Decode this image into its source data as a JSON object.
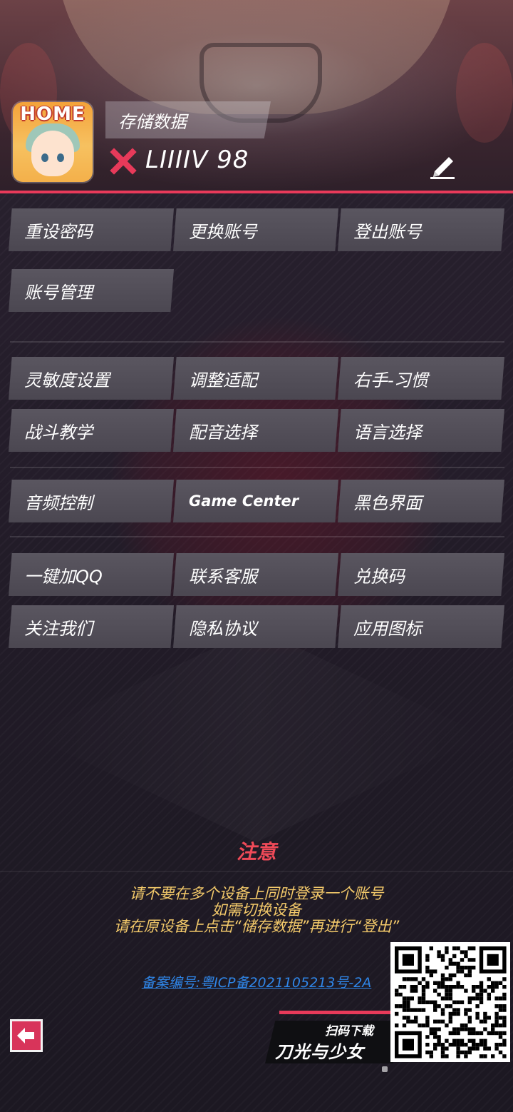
{
  "profile": {
    "avatar_badge": "HOME",
    "storage_label": "存储数据",
    "level_text": "LIIIIV 98",
    "status_icon": "cross-icon",
    "edit_icon": "pencil-icon"
  },
  "account_buttons": [
    {
      "label": "重设密码"
    },
    {
      "label": "更换账号"
    },
    {
      "label": "登出账号"
    },
    {
      "label": "账号管理"
    }
  ],
  "settings_buttons": [
    {
      "label": "灵敏度设置"
    },
    {
      "label": "调整适配"
    },
    {
      "label": "右手-习惯"
    },
    {
      "label": "战斗教学"
    },
    {
      "label": "配音选择"
    },
    {
      "label": "语言选择"
    }
  ],
  "system_buttons": [
    {
      "label": "音频控制"
    },
    {
      "label": "Game Center"
    },
    {
      "label": "黑色界面"
    }
  ],
  "social_buttons": [
    {
      "label": "一键加QQ"
    },
    {
      "label": "联系客服"
    },
    {
      "label": "兑换码"
    },
    {
      "label": "关注我们"
    },
    {
      "label": "隐私协议"
    },
    {
      "label": "应用图标"
    }
  ],
  "notice": {
    "title": "注意",
    "lines": [
      "请不要在多个设备上同时登录一个账号",
      "如需切换设备",
      "请在原设备上点击“储存数据”再进行“登出”"
    ],
    "icp": "备案编号:粤ICP备2021105213号-2A"
  },
  "promo": {
    "scan_label": "扫码下载",
    "game_name": "刀光与少女"
  },
  "colors": {
    "accent": "#e83a5a",
    "notice_title": "#f04a58",
    "notice_text": "#f3c96a",
    "link": "#2f86e8",
    "button_bg": "#55515b"
  }
}
